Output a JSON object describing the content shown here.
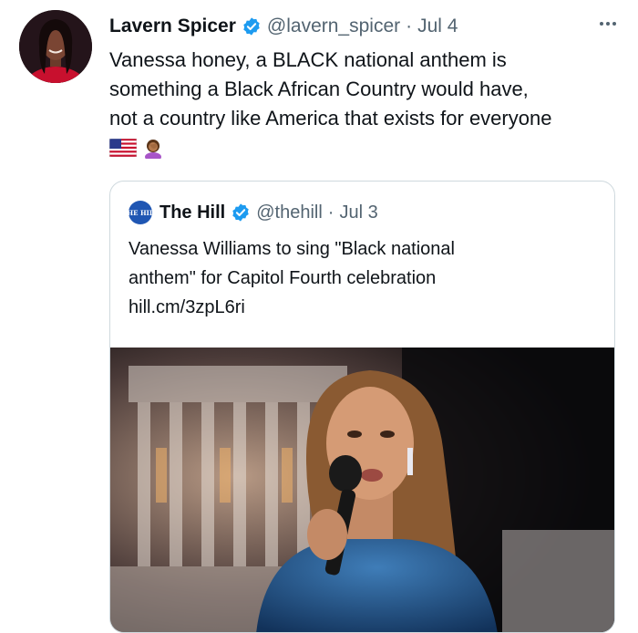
{
  "tweet": {
    "author_name": "Lavern Spicer",
    "author_handle": "@lavern_spicer",
    "separator": "·",
    "date": "Jul 4",
    "text_lines": [
      "Vanessa honey, a BLACK national anthem is",
      "something a Black African Country would have,",
      "not a country like America that exists for everyone"
    ],
    "emojis": [
      "us-flag-emoji",
      "woman-facepalming-emoji"
    ]
  },
  "quoted": {
    "logo_text": "THE HILL",
    "author_name": "The Hill",
    "author_handle": "@thehill",
    "separator": "·",
    "date": "Jul 3",
    "text_lines": [
      "Vanessa Williams to sing \"Black national",
      "anthem\" for Capitol Fourth celebration",
      "hill.cm/3zpL6ri"
    ]
  },
  "colors": {
    "verified": "#1d9bf0",
    "secondary_text": "#536471",
    "border": "#cfd9de",
    "hill_logo": "#1f56b3"
  }
}
